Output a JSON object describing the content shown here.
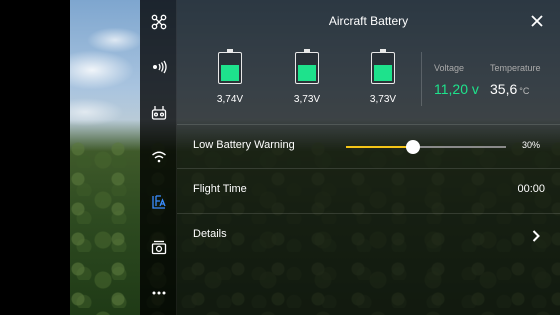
{
  "panel": {
    "title": "Aircraft Battery"
  },
  "battery": {
    "cells": [
      {
        "voltage": "3,74V",
        "level": 0.6
      },
      {
        "voltage": "3,73V",
        "level": 0.6
      },
      {
        "voltage": "3,73V",
        "level": 0.6
      }
    ],
    "voltage_label": "Voltage",
    "voltage_value": "11,20 v",
    "temperature_label": "Temperature",
    "temperature_value": "35,6",
    "temperature_unit": "°C",
    "voltage_color": "#1ee28c",
    "cell_fill_color": "#1ee28c"
  },
  "settings": {
    "low_battery_warning": {
      "label": "Low Battery Warning",
      "value_text": "30%",
      "value": 0.3,
      "accent_color": "#f5c518"
    },
    "flight_time": {
      "label": "Flight Time",
      "value": "00:00"
    },
    "details": {
      "label": "Details"
    }
  },
  "sidebar": {
    "icons": [
      "aircraft-icon",
      "signal-icon",
      "remote-controller-icon",
      "wifi-icon",
      "battery-settings-icon",
      "camera-icon",
      "more-icon"
    ]
  }
}
